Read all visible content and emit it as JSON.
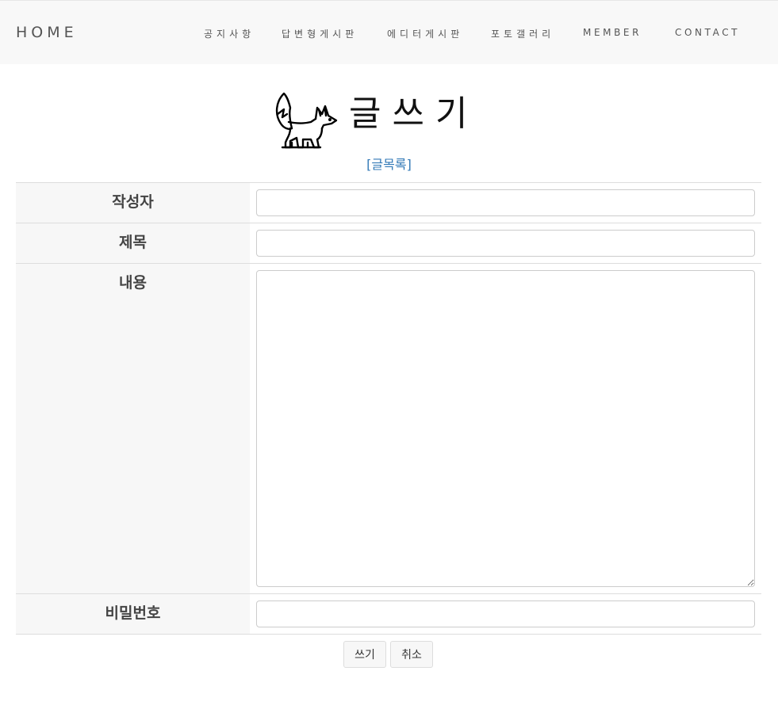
{
  "nav": {
    "brand": "HOME",
    "items": [
      "공지사항",
      "답변형게시판",
      "에디터게시판",
      "포토갤러리",
      "MEMBER",
      "CONTACT"
    ]
  },
  "header": {
    "icon": "fox-icon",
    "title": "글쓰기",
    "list_link": "[글목록]"
  },
  "form": {
    "writer_label": "작성자",
    "title_label": "제목",
    "content_label": "내용",
    "password_label": "비밀번호",
    "writer_value": "",
    "title_value": "",
    "content_value": "",
    "password_value": ""
  },
  "buttons": {
    "write": "쓰기",
    "cancel": "취소"
  },
  "colors": {
    "link": "#337ab7",
    "navbar_bg": "#f8f8f8",
    "label_bg": "#f7f7f7"
  }
}
